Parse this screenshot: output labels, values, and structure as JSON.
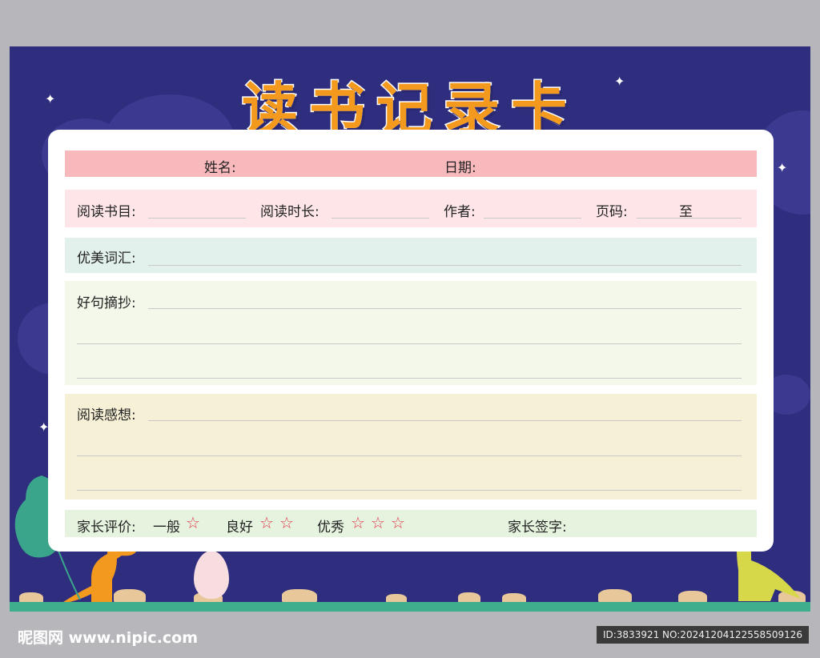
{
  "title": "读书记录卡",
  "header_row": {
    "name_label": "姓名:",
    "date_label": "日期:"
  },
  "info_row": {
    "book_label": "阅读书目:",
    "duration_label": "阅读时长:",
    "author_label": "作者:",
    "pages_label": "页码:",
    "pages_to": "至"
  },
  "vocab_label": "优美词汇:",
  "sentences_label": "好句摘抄:",
  "thoughts_label": "阅读感想:",
  "eval_row": {
    "parent_eval_label": "家长评价:",
    "level_1": "一般",
    "level_2": "良好",
    "level_3": "优秀",
    "star": "☆",
    "signature_label": "家长签字:"
  },
  "watermark": "昵图网 www.nipic.com",
  "image_id": "ID:3833921 NO:20241204122558509126",
  "colors": {
    "background": "#2f2d7e",
    "title": "#f39a1e",
    "header_row": "#f8b9bd",
    "info_row": "#fde5e8",
    "vocab_row": "#e3f1ec",
    "sentences_row": "#f4f8ea",
    "thoughts_row": "#f6f0d6",
    "eval_row": "#e6f4df"
  }
}
